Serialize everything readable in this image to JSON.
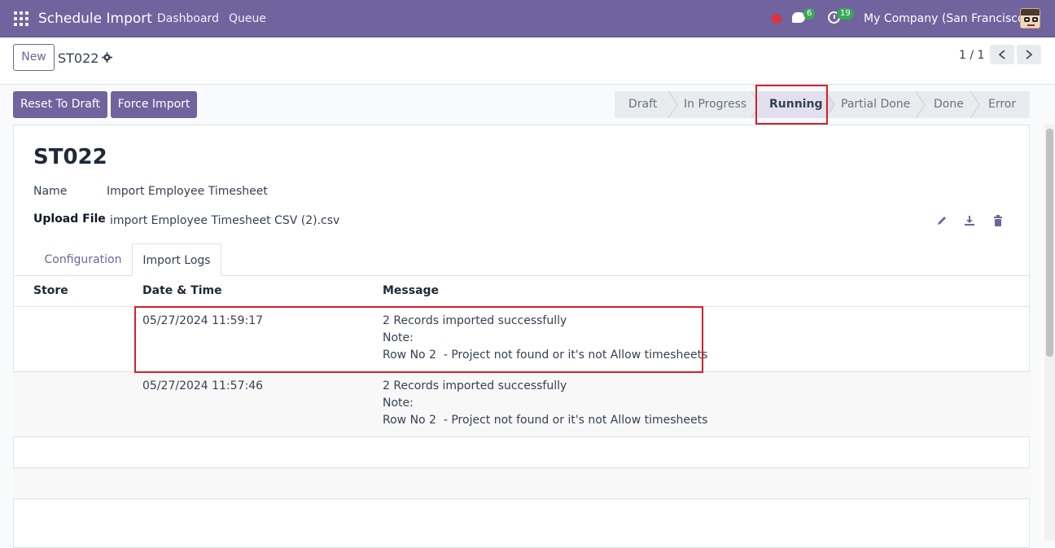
{
  "navbar": {
    "app_title": "Schedule Import",
    "menu": [
      "Dashboard",
      "Queue"
    ],
    "chat_count": "6",
    "activity_count": "19",
    "company": "My Company (San Francisco)"
  },
  "control": {
    "new_label": "New",
    "record_ref": "ST022",
    "pager": "1 / 1"
  },
  "actions": {
    "reset_label": "Reset To Draft",
    "force_label": "Force Import"
  },
  "statusbar": {
    "stages": [
      "Draft",
      "In Progress",
      "Running",
      "Partial Done",
      "Done",
      "Error"
    ],
    "active": "Running"
  },
  "form": {
    "title": "ST022",
    "name_label": "Name",
    "name_value": "Import Employee Timesheet",
    "file_label": "Upload File",
    "file_value": "import Employee Timesheet CSV (2).csv"
  },
  "tabs": [
    "Configuration",
    "Import Logs"
  ],
  "logs": {
    "headers": [
      "Store",
      "Date & Time",
      "Message"
    ],
    "rows": [
      {
        "store": "",
        "datetime": "05/27/2024 11:59:17",
        "msg1": "2 Records imported successfully",
        "msg2": "Note:",
        "msg3": "Row No 2  - Project not found or it's not Allow timesheets"
      },
      {
        "store": "",
        "datetime": "05/27/2024 11:57:46",
        "msg1": "2 Records imported successfully",
        "msg2": "Note:",
        "msg3": "Row No 2  - Project not found or it's not Allow timesheets"
      }
    ]
  },
  "colors": {
    "brand": "#71639e",
    "badge": "#3aa859",
    "highlight": "#d5202a"
  }
}
